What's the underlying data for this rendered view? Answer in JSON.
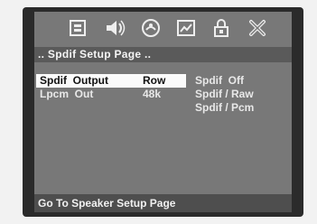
{
  "toolbar": {
    "icons": [
      "general-setup-icon",
      "audio-setup-icon",
      "dolby-setup-icon",
      "video-setup-icon",
      "preference-lock-icon",
      "exit-icon"
    ]
  },
  "page": {
    "title": ".. Spdif Setup Page .."
  },
  "menu": {
    "items": [
      {
        "label": "Spdif  Output",
        "value": "Row",
        "selected": true
      },
      {
        "label": "Lpcm  Out",
        "value": "48k",
        "selected": false
      }
    ]
  },
  "options": [
    "Spdif  Off",
    "Spdif / Raw",
    "Spdif / Pcm"
  ],
  "footer": {
    "text": "Go To Speaker Setup Page"
  },
  "colors": {
    "screen": "#787878",
    "titlebar": "#5a5a5a",
    "selection": "#fafafa",
    "text": "#e8e8e8"
  }
}
